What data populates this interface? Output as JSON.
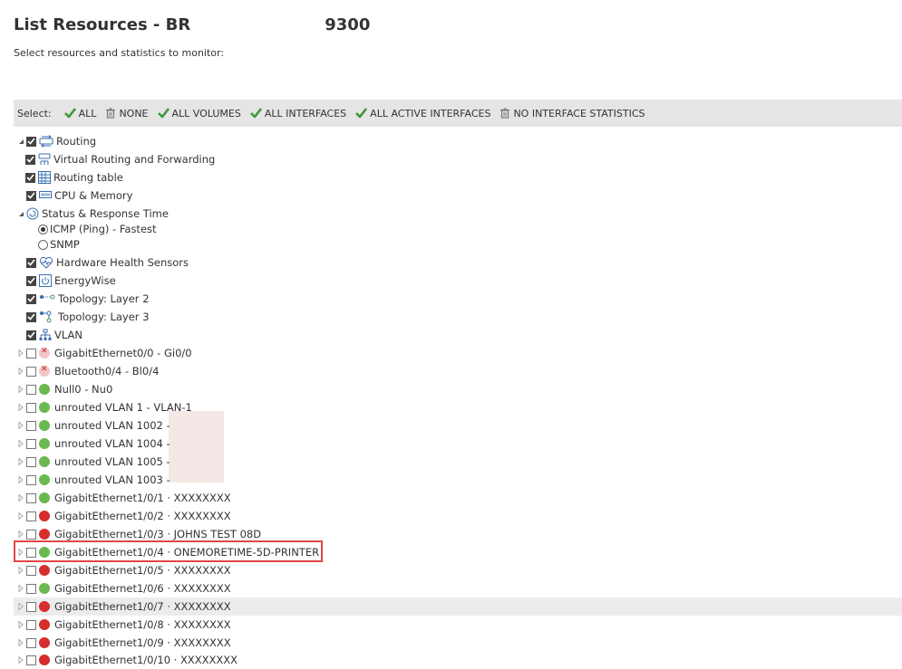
{
  "header": {
    "title_prefix": "List Resources - BR",
    "title_suffix": "9300",
    "subtitle": "Select resources and statistics to monitor:"
  },
  "select_bar": {
    "label": "Select:",
    "options": [
      {
        "label": "ALL",
        "icon": "check-icon"
      },
      {
        "label": "NONE",
        "icon": "trash-icon"
      },
      {
        "label": "ALL VOLUMES",
        "icon": "check-icon"
      },
      {
        "label": "ALL INTERFACES",
        "icon": "check-icon"
      },
      {
        "label": "ALL ACTIVE INTERFACES",
        "icon": "check-icon"
      },
      {
        "label": "NO INTERFACE STATISTICS",
        "icon": "trash-icon"
      }
    ]
  },
  "tree": {
    "rows": [
      {
        "label": "Routing",
        "checked": true,
        "expanded": true,
        "icon": "routing-icon"
      },
      {
        "label": "Virtual Routing and Forwarding",
        "checked": true,
        "icon": "vrf-icon"
      },
      {
        "label": "Routing table",
        "checked": true,
        "icon": "table-icon"
      },
      {
        "label": "CPU & Memory",
        "checked": true,
        "icon": "cpu-icon"
      },
      {
        "label": "Status & Response Time",
        "expanded": true,
        "icon": "status-icon"
      },
      {
        "label": "ICMP (Ping) - Fastest",
        "radio": true,
        "selected": true
      },
      {
        "label": "SNMP",
        "radio": true,
        "selected": false
      },
      {
        "label": "Hardware Health Sensors",
        "checked": true,
        "icon": "heartbeat-icon"
      },
      {
        "label": "EnergyWise",
        "checked": true,
        "icon": "power-icon"
      },
      {
        "label": "Topology: Layer 2",
        "checked": true,
        "icon": "topology-l2-icon"
      },
      {
        "label": "Topology: Layer 3",
        "checked": true,
        "icon": "topology-l3-icon"
      },
      {
        "label": "VLAN",
        "checked": true,
        "icon": "vlan-icon"
      },
      {
        "label": "GigabitEthernet0/0 - Gi0/0",
        "checked": false,
        "status": "x"
      },
      {
        "label": "Bluetooth0/4 - Bl0/4",
        "checked": false,
        "status": "x"
      },
      {
        "label": "Null0 - Nu0",
        "checked": false,
        "status": "green"
      },
      {
        "label": "unrouted VLAN 1 - VLAN-1",
        "checked": false,
        "status": "green"
      },
      {
        "label": "unrouted VLAN 1002 -",
        "checked": false,
        "status": "green"
      },
      {
        "label": "unrouted VLAN 1004 -",
        "checked": false,
        "status": "green"
      },
      {
        "label": "unrouted VLAN 1005 -",
        "checked": false,
        "status": "green"
      },
      {
        "label": "unrouted VLAN 1003 -",
        "checked": false,
        "status": "green"
      },
      {
        "label": "GigabitEthernet1/0/1 · XXXXXXXX",
        "checked": false,
        "status": "green"
      },
      {
        "label": "GigabitEthernet1/0/2 · XXXXXXXX",
        "checked": false,
        "status": "red"
      },
      {
        "label": "GigabitEthernet1/0/3 · JOHNS TEST 08D",
        "checked": false,
        "status": "red"
      },
      {
        "label": "GigabitEthernet1/0/4 · ONEMORETIME-5D-PRINTER",
        "checked": false,
        "status": "green",
        "highlighted": true
      },
      {
        "label": "GigabitEthernet1/0/5 · XXXXXXXX",
        "checked": false,
        "status": "red"
      },
      {
        "label": "GigabitEthernet1/0/6 · XXXXXXXX",
        "checked": false,
        "status": "green"
      },
      {
        "label": "GigabitEthernet1/0/7 · XXXXXXXX",
        "checked": false,
        "status": "red",
        "hover": true
      },
      {
        "label": "GigabitEthernet1/0/8 · XXXXXXXX",
        "checked": false,
        "status": "red"
      },
      {
        "label": "GigabitEthernet1/0/9 · XXXXXXXX",
        "checked": false,
        "status": "red"
      },
      {
        "label": "GigabitEthernet1/0/10 · XXXXXXXX",
        "checked": false,
        "status": "red"
      }
    ]
  }
}
